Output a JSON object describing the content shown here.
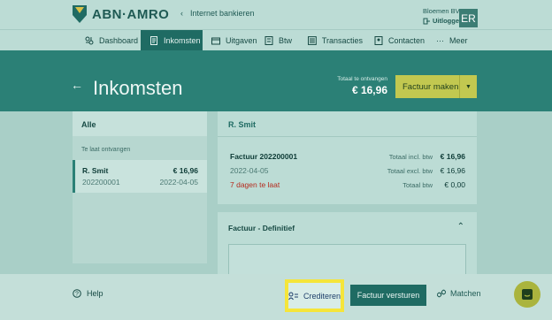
{
  "brand": {
    "name": "ABN·AMRO",
    "primary_color": "#2b8076",
    "accent_color": "#c2c850"
  },
  "header": {
    "back_link": "Internet bankieren",
    "account_name": "Bloemen BV",
    "logout": "Uitloggen",
    "badge": "ER"
  },
  "nav": {
    "items": [
      {
        "label": "Dashboard",
        "icon": "dashboard-icon"
      },
      {
        "label": "Inkomsten",
        "icon": "document-icon",
        "active": true
      },
      {
        "label": "Uitgaven",
        "icon": "wallet-icon"
      },
      {
        "label": "Btw",
        "icon": "receipt-icon"
      },
      {
        "label": "Transacties",
        "icon": "list-icon"
      },
      {
        "label": "Contacten",
        "icon": "contact-icon"
      },
      {
        "label": "Meer",
        "icon": "more-icon"
      }
    ]
  },
  "page": {
    "title": "Inkomsten",
    "total_label": "Totaal te ontvangen",
    "total_value": "€ 16,96",
    "create_button": "Factuur maken"
  },
  "list": {
    "header": "Alle",
    "section": "Te laat ontvangen",
    "items": [
      {
        "name": "R. Smit",
        "amount": "€ 16,96",
        "number": "202200001",
        "date": "2022-04-05"
      }
    ]
  },
  "detail": {
    "customer": "R. Smit",
    "invoice_title": "Factuur 202200001",
    "invoice_date": "2022-04-05",
    "overdue": "7 dagen te laat",
    "rows": [
      {
        "label": "Totaal incl. btw",
        "value": "€ 16,96"
      },
      {
        "label": "Totaal excl. btw",
        "value": "€ 16,96"
      },
      {
        "label": "Totaal btw",
        "value": "€ 0,00"
      }
    ],
    "final_section": "Factuur - Definitief"
  },
  "footer": {
    "help": "Help",
    "credit": "Crediteren",
    "send": "Factuur versturen",
    "match": "Matchen"
  }
}
